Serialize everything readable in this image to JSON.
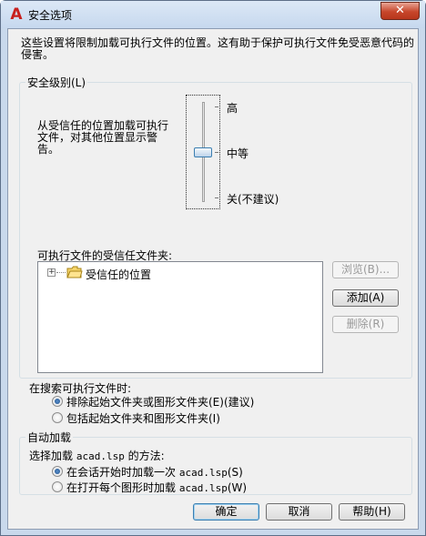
{
  "window": {
    "title": "安全选项",
    "close_label": "✕",
    "app_icon": "autocad-A-icon"
  },
  "intro_text": "这些设置将限制加载可执行文件的位置。这有助于保护可执行文件免受恶意代码的侵害。",
  "security_level": {
    "group_label": "安全级别(L)",
    "description": "从受信任的位置加载可执行文件，对其他位置显示警告。",
    "levels": [
      "高",
      "中等",
      "关(不建议)"
    ],
    "selected": "中等",
    "trusted_folders_label": "可执行文件的受信任文件夹:",
    "tree_item": "受信任的位置",
    "buttons": {
      "browse": "浏览(B)...",
      "add": "添加(A)",
      "remove": "删除(R)"
    }
  },
  "search": {
    "label": "在搜索可执行文件时:",
    "options": [
      "排除起始文件夹或图形文件夹(E)(建议)",
      "包括起始文件夹和图形文件夹(I)"
    ],
    "selected_index": 0
  },
  "autoload": {
    "group_label": "自动加载",
    "method_prefix": "选择加载",
    "method_file": "acad.lsp",
    "method_suffix": "的方法:",
    "option1_prefix": "在会话开始时加载一次",
    "option1_file": "acad.lsp",
    "option1_suffix": "(S)",
    "option2_prefix": "在打开每个图形时加载",
    "option2_file": "acad.lsp",
    "option2_suffix": "(W)",
    "selected_index": 0
  },
  "footer": {
    "ok": "确定",
    "cancel": "取消",
    "help": "帮助(H)"
  }
}
